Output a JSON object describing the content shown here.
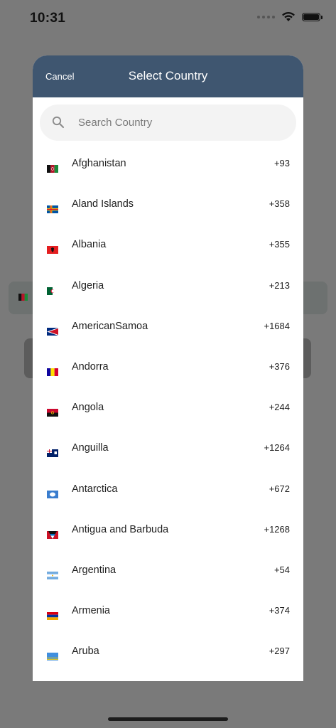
{
  "status_bar": {
    "time": "10:31"
  },
  "modal": {
    "title": "Select Country",
    "cancel_label": "Cancel",
    "search_placeholder": "Search Country"
  },
  "countries": [
    {
      "name": "Afghanistan",
      "code": "+93",
      "flag": "af-flag-icon"
    },
    {
      "name": "Aland Islands",
      "code": "+358",
      "flag": "ax-flag-icon"
    },
    {
      "name": "Albania",
      "code": "+355",
      "flag": "al-flag-icon"
    },
    {
      "name": "Algeria",
      "code": "+213",
      "flag": "dz-flag-icon"
    },
    {
      "name": "AmericanSamoa",
      "code": "+1684",
      "flag": "as-flag-icon"
    },
    {
      "name": "Andorra",
      "code": "+376",
      "flag": "ad-flag-icon"
    },
    {
      "name": "Angola",
      "code": "+244",
      "flag": "ao-flag-icon"
    },
    {
      "name": "Anguilla",
      "code": "+1264",
      "flag": "ai-flag-icon"
    },
    {
      "name": "Antarctica",
      "code": "+672",
      "flag": "aq-flag-icon"
    },
    {
      "name": "Antigua and Barbuda",
      "code": "+1268",
      "flag": "ag-flag-icon"
    },
    {
      "name": "Argentina",
      "code": "+54",
      "flag": "ar-flag-icon"
    },
    {
      "name": "Armenia",
      "code": "+374",
      "flag": "am-flag-icon"
    },
    {
      "name": "Aruba",
      "code": "+297",
      "flag": "aw-flag-icon"
    }
  ],
  "colors": {
    "header": "#3f5670",
    "overlay": "#7a7a7a",
    "search_bg": "#f3f3f3"
  }
}
